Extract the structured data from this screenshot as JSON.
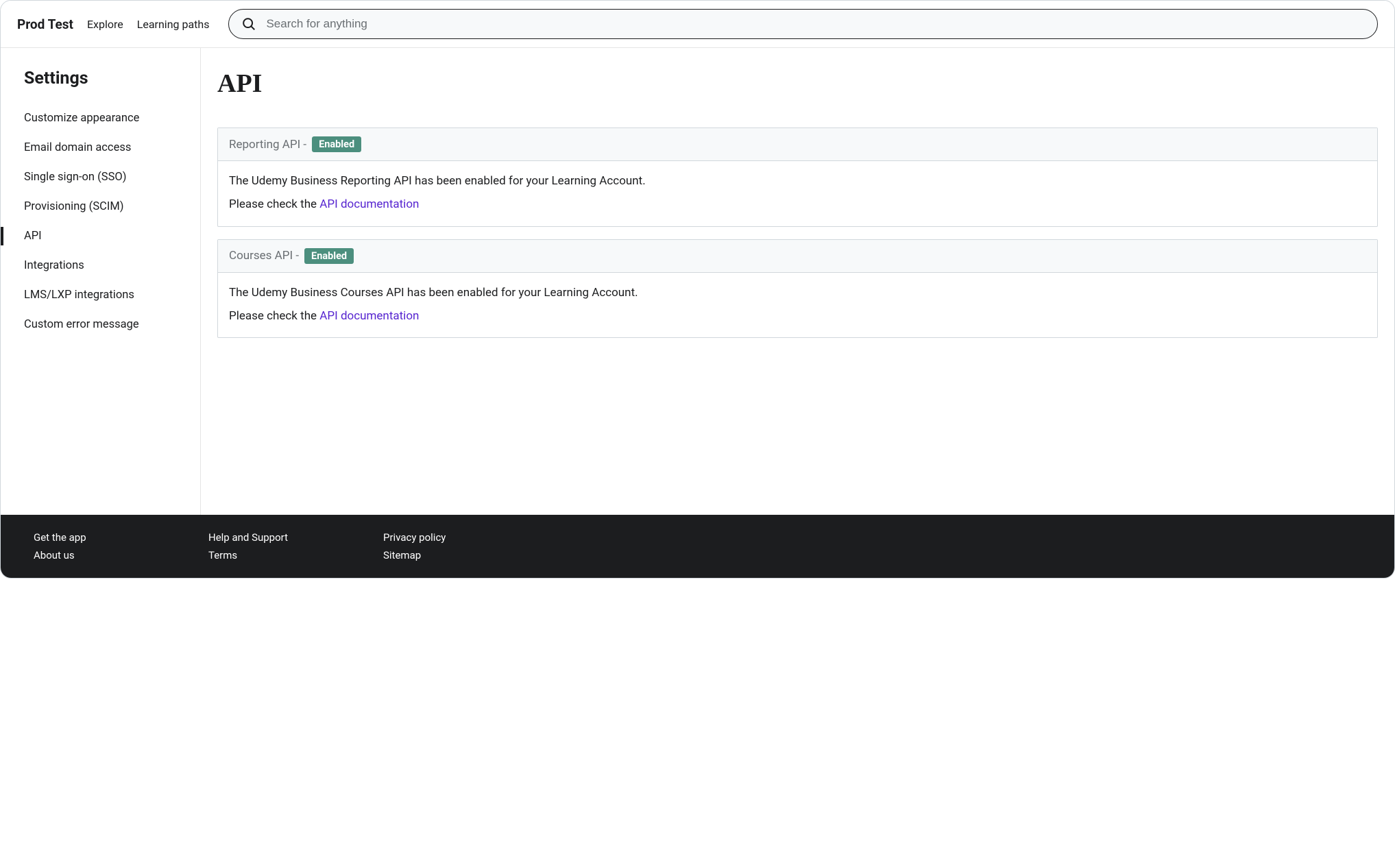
{
  "header": {
    "brand": "Prod Test",
    "nav": [
      "Explore",
      "Learning paths"
    ],
    "search_placeholder": "Search for anything"
  },
  "sidebar": {
    "title": "Settings",
    "items": [
      "Customize appearance",
      "Email domain access",
      "Single sign-on (SSO)",
      "Provisioning (SCIM)",
      "API",
      "Integrations",
      "LMS/LXP integrations",
      "Custom error message"
    ],
    "active_index": 4
  },
  "main": {
    "title": "API",
    "cards": [
      {
        "title": "Reporting API -",
        "badge": "Enabled",
        "line1": "The Udemy Business Reporting API has been enabled for your Learning Account.",
        "line2_prefix": "Please check the ",
        "line2_link": "API documentation"
      },
      {
        "title": "Courses API -",
        "badge": "Enabled",
        "line1": "The Udemy Business Courses API has been enabled for your Learning Account.",
        "line2_prefix": "Please check the ",
        "line2_link": "API documentation"
      }
    ]
  },
  "footer": {
    "columns": [
      [
        "Get the app",
        "About us"
      ],
      [
        "Help and Support",
        "Terms"
      ],
      [
        "Privacy policy",
        "Sitemap"
      ]
    ]
  }
}
